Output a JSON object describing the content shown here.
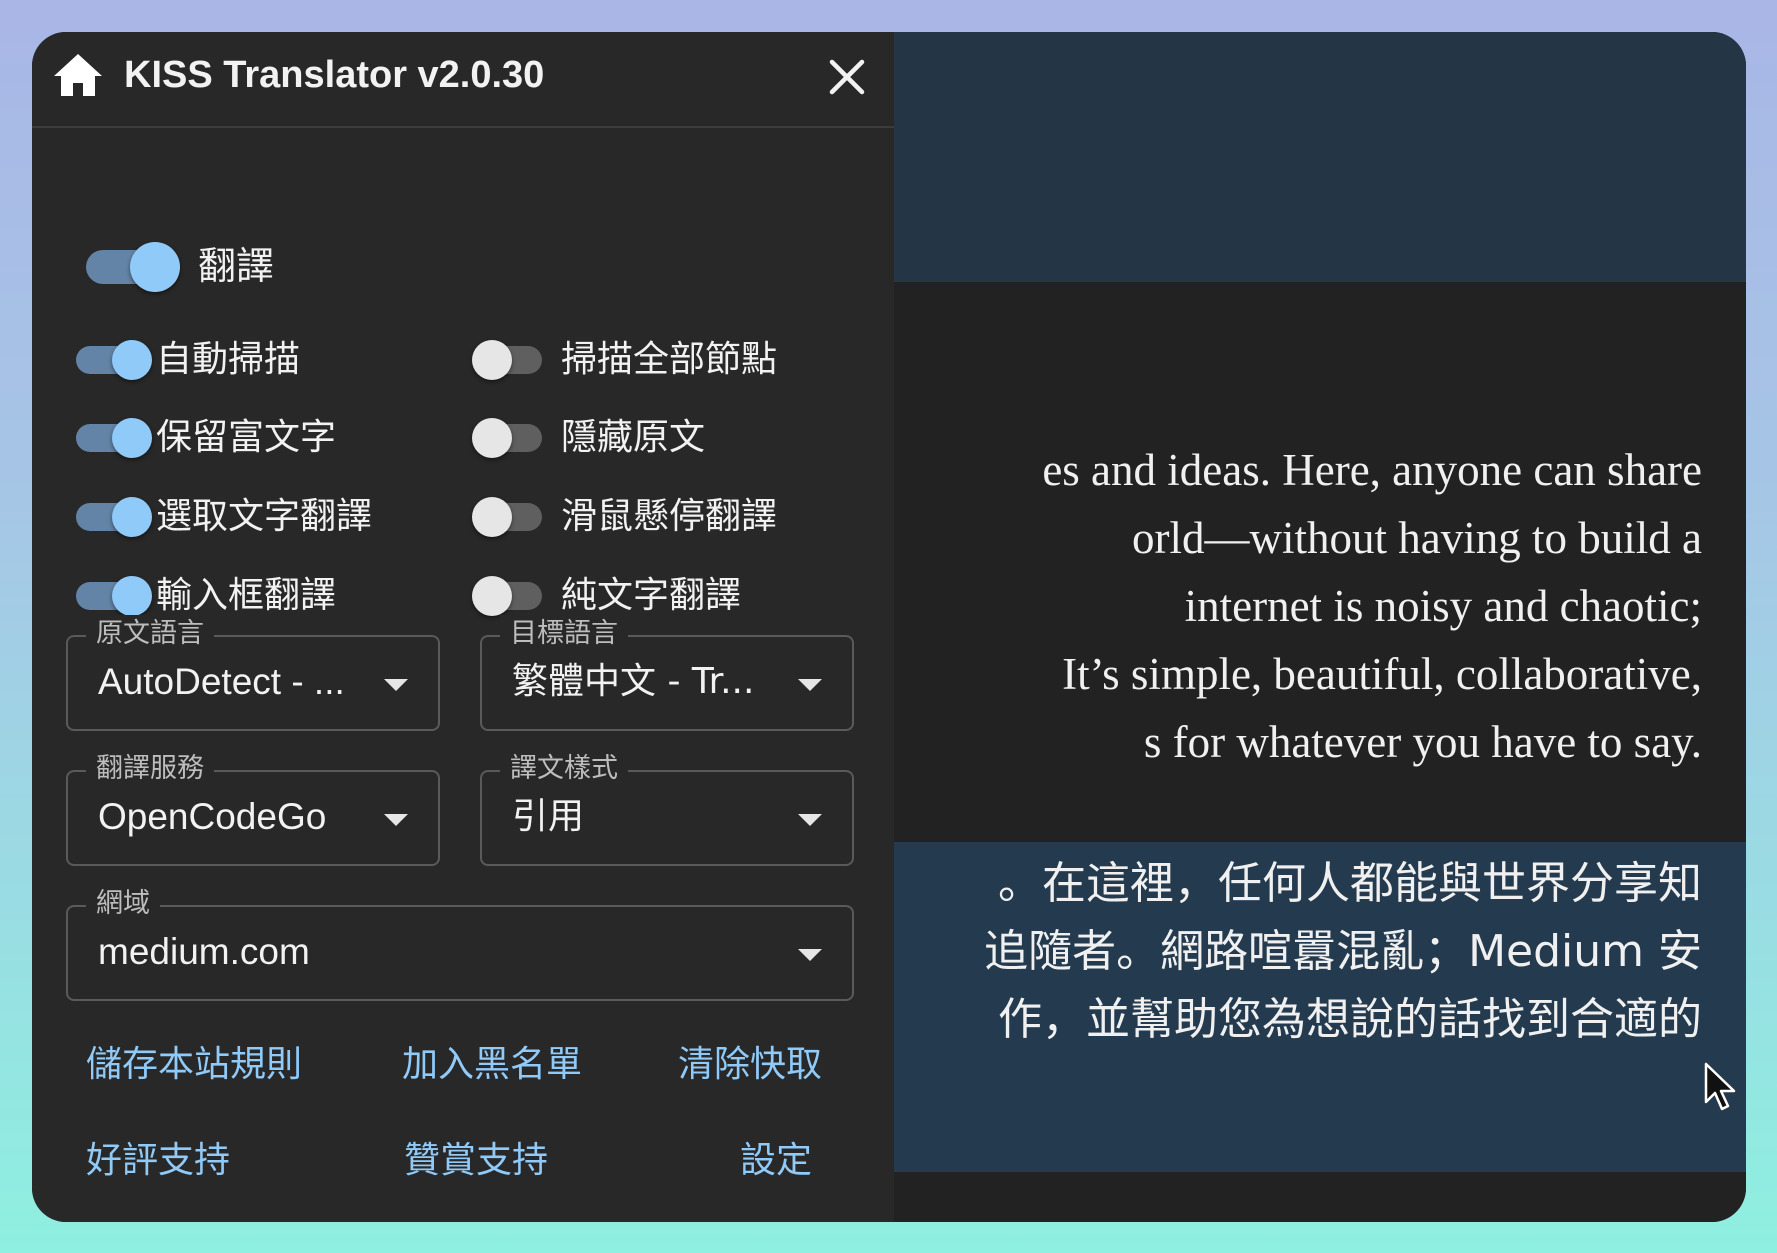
{
  "popup": {
    "title": "KISS Translator v2.0.30",
    "master_toggle": {
      "label": "翻譯",
      "on": true
    },
    "toggles_left": [
      {
        "label": "自動掃描",
        "on": true
      },
      {
        "label": "保留富文字",
        "on": true
      },
      {
        "label": "選取文字翻譯",
        "on": true
      },
      {
        "label": "輸入框翻譯",
        "on": true
      }
    ],
    "toggles_right": [
      {
        "label": "掃描全部節點",
        "on": false
      },
      {
        "label": "隱藏原文",
        "on": false
      },
      {
        "label": "滑鼠懸停翻譯",
        "on": false
      },
      {
        "label": "純文字翻譯",
        "on": false
      }
    ],
    "selects": {
      "source_lang": {
        "label": "原文語言",
        "value": "AutoDetect - ..."
      },
      "target_lang": {
        "label": "目標語言",
        "value": "繁體中文 - Tr..."
      },
      "service": {
        "label": "翻譯服務",
        "value": "OpenCodeGo"
      },
      "style": {
        "label": "譯文樣式",
        "value": "引用"
      },
      "domain": {
        "label": "網域",
        "value": "medium.com"
      }
    },
    "actions_row1": [
      "儲存本站規則",
      "加入黑名單",
      "清除快取"
    ],
    "actions_row2": [
      "好評支持",
      "贊賞支持",
      "設定"
    ]
  },
  "article": {
    "lines": [
      "es and ideas. Here, anyone can share",
      "orld—without having to build a",
      "internet is noisy and chaotic;",
      "It’s simple, beautiful, collaborative,",
      "s for whatever you have to say."
    ],
    "translation_lines": [
      "。在這裡，任何人都能與世界分享知",
      "追隨者。網路喧囂混亂；Medium 安",
      "作，並幫助您為想說的話找到合適的"
    ]
  },
  "colors": {
    "accent": "#90caf9",
    "panel_bg": "#282828",
    "page_header_bg": "#243646",
    "translation_bg": "#243a4e"
  }
}
